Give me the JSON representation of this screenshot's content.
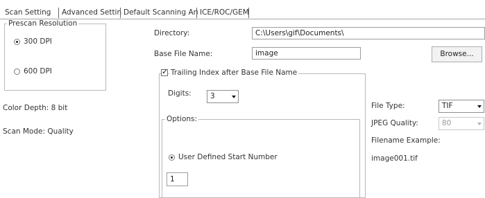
{
  "tabs": [
    {
      "label": "Scan Setting"
    },
    {
      "label": "Advanced Setting"
    },
    {
      "label": "Default Scanning Area"
    },
    {
      "label": "ICE/ROC/GEM"
    }
  ],
  "prescan": {
    "legend": "Prescan Resolution",
    "options": [
      {
        "label": "300 DPI",
        "selected": true
      },
      {
        "label": "600 DPI",
        "selected": false
      }
    ]
  },
  "status": {
    "color_depth": "Color Depth: 8 bit",
    "scan_mode": "Scan Mode: Quality"
  },
  "directory": {
    "label": "Directory:",
    "value": "C:\\Users\\gif\\Documents\\"
  },
  "base_name": {
    "label": "Base File Name:",
    "value": "image"
  },
  "browse_label": "Browse...",
  "trailing": {
    "label": "Trailing Index after Base File Name",
    "checked": true,
    "digits_label": "Digits:",
    "digits_value": "3",
    "options_legend": "Options:",
    "start_option_label": "User Defined Start Number",
    "start_option_selected": true,
    "start_value": "1"
  },
  "file_type": {
    "label": "File Type:",
    "value": "TIF"
  },
  "jpeg_quality": {
    "label": "JPEG Quality:",
    "value": "80"
  },
  "filename_example": {
    "label": "Filename Example:",
    "value": "image001.tif"
  }
}
